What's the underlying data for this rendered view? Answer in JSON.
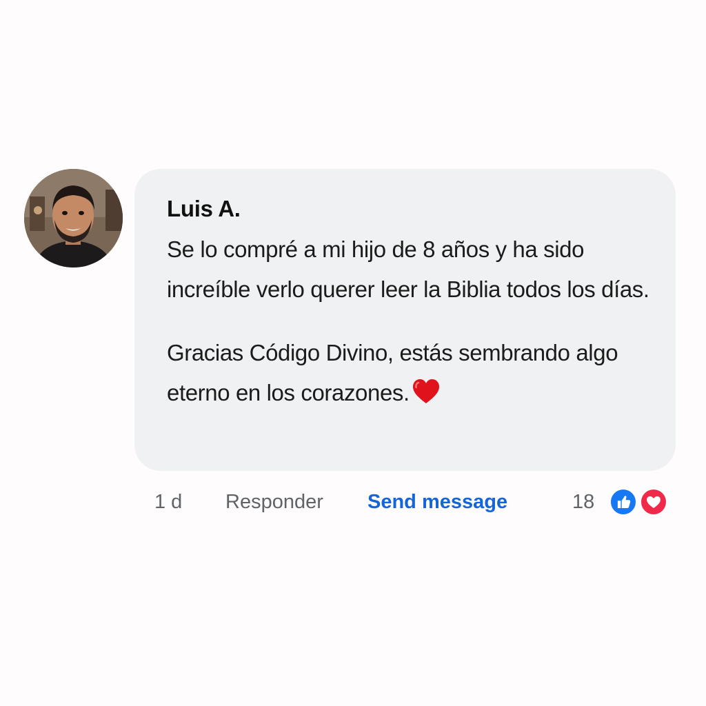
{
  "comment": {
    "author": "Luis A.",
    "paragraphs": [
      "Se lo compré a mi hijo de 8 años y ha sido increíble verlo querer leer la Biblia todos los días.",
      "Gracias Código Divino, estás sembrando algo eterno en los corazones."
    ],
    "emoji": "red-heart-emoji"
  },
  "actions": {
    "time": "1 d",
    "reply_label": "Responder",
    "send_label": "Send message",
    "reaction_count": "18",
    "reactions": [
      "like-icon",
      "love-icon"
    ]
  },
  "colors": {
    "bubble": "#f0f1f3",
    "link": "#1565d8",
    "muted": "#5f6368",
    "like": "#1877f2",
    "love": "#f02849"
  }
}
